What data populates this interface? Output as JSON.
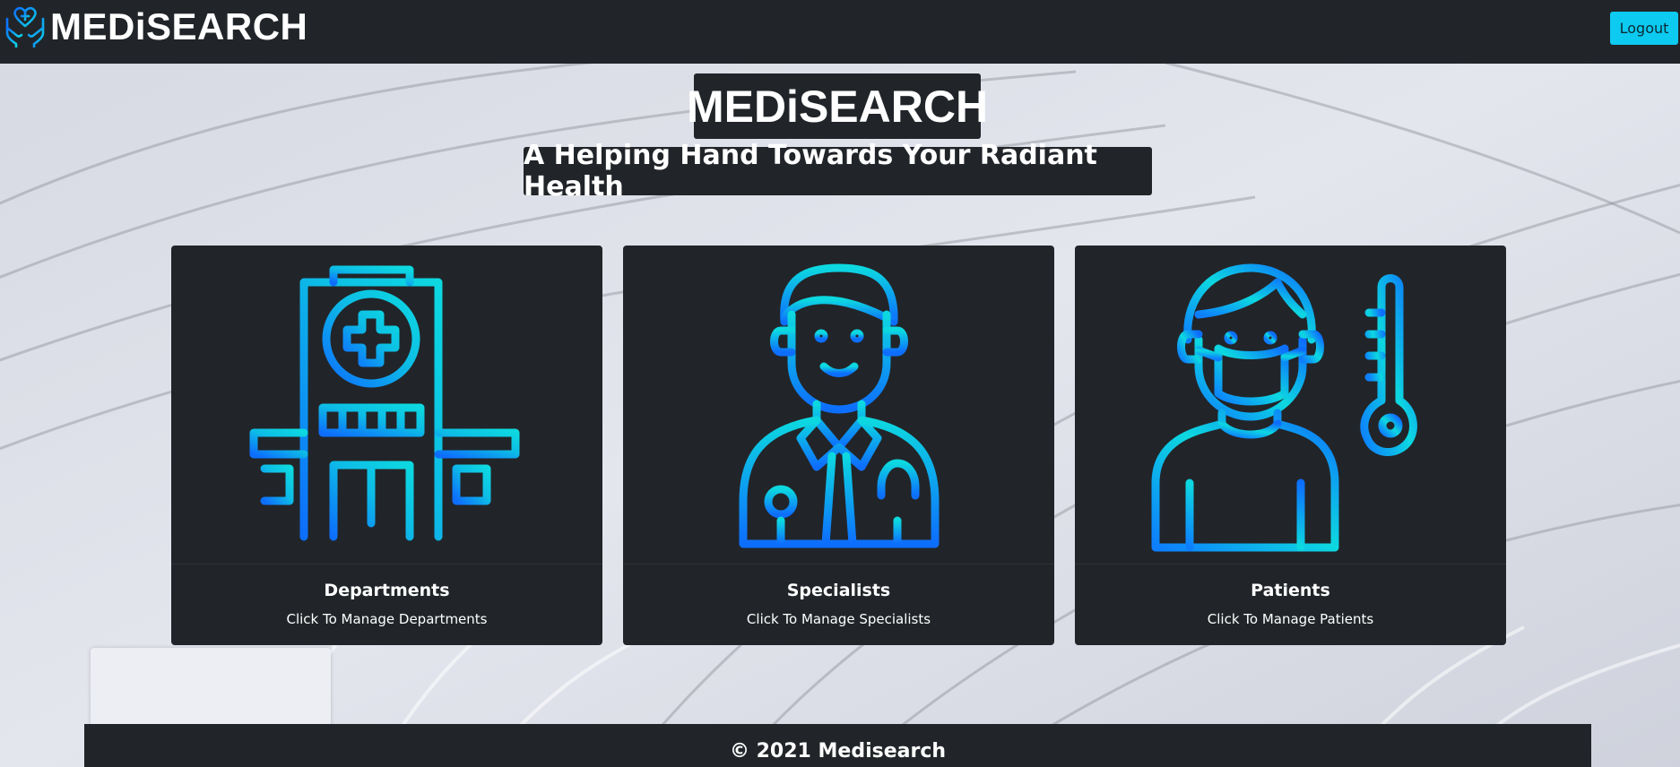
{
  "brand": {
    "name": "MEDiSEARCH",
    "logo_icon": "heart-hands-icon"
  },
  "nav": {
    "logout_label": "Logout"
  },
  "hero": {
    "title": "MEDiSEARCH",
    "subtitle": "A Helping Hand Towards Your Radiant Health"
  },
  "cards": [
    {
      "title": "Departments",
      "text": "Click To Manage Departments",
      "icon": "hospital-icon"
    },
    {
      "title": "Specialists",
      "text": "Click To Manage Specialists",
      "icon": "doctor-icon"
    },
    {
      "title": "Patients",
      "text": "Click To Manage Patients",
      "icon": "patient-icon"
    }
  ],
  "footer": {
    "text": "© 2021 Medisearch"
  },
  "colors": {
    "dark": "#212529",
    "accent": "#0dcaf0",
    "icon_gradient_start": "#0d6efd",
    "icon_gradient_end": "#0dd5e6"
  }
}
